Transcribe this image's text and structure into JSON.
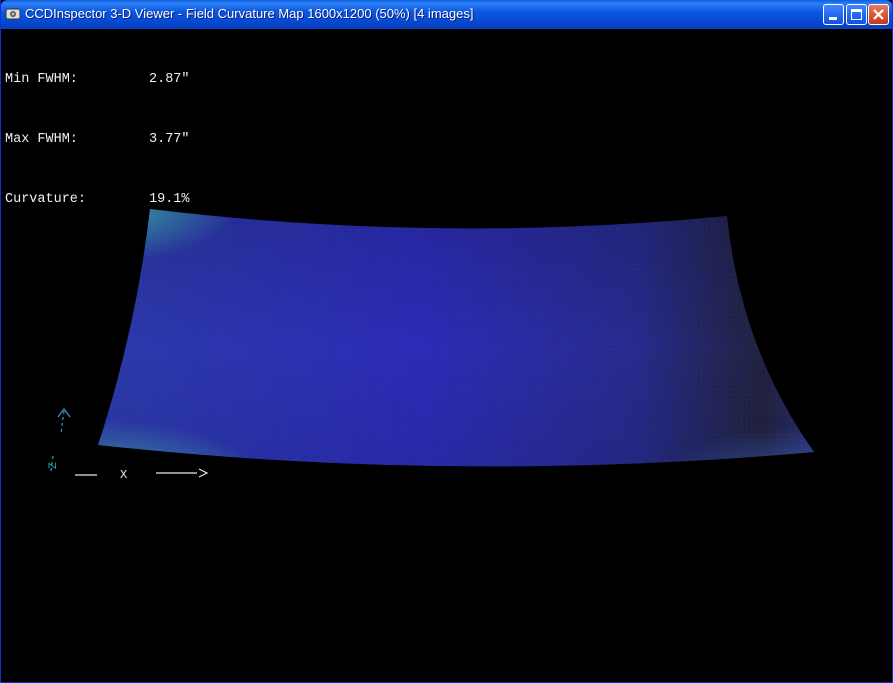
{
  "window": {
    "title": "CCDInspector 3-D Viewer - Field Curvature Map 1600x1200 (50%)  [4 images]",
    "buttons": [
      "minimize",
      "maximize",
      "close"
    ]
  },
  "stats": {
    "min_fwhm": {
      "label": "Min FWHM:",
      "value": "2.87\""
    },
    "max_fwhm": {
      "label": "Max FWHM:",
      "value": "3.77\""
    },
    "curvature": {
      "label": "Curvature:",
      "value": "19.1%"
    }
  },
  "axes": {
    "x_label": "X",
    "y_label": "Y",
    "z_label": "Z"
  },
  "colors": {
    "background": "#000000",
    "surface_main": "#2a2bb0",
    "surface_dark": "#22223a",
    "surface_edge": "#3a9aa8",
    "axis_xyz_color": "#2fa0b0",
    "text": "#f0f0f0"
  }
}
